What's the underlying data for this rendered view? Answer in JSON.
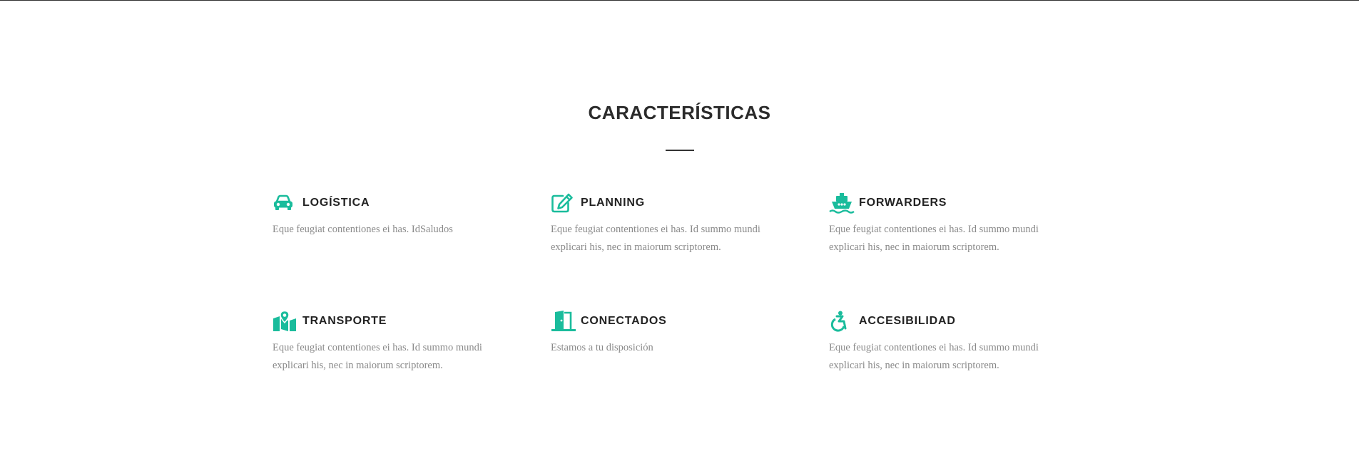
{
  "section": {
    "title": "CARACTERÍSTICAS"
  },
  "theme": {
    "accent": "#1abc9c",
    "heading": "#222222",
    "text": "#8a8a8a"
  },
  "features": [
    {
      "icon": "car-icon",
      "title": "LOGÍSTICA",
      "text": "Eque feugiat contentiones ei has. IdSaludos"
    },
    {
      "icon": "edit-icon",
      "title": "PLANNING",
      "text": "Eque feugiat contentiones ei has. Id summo mundi explicari his, nec in maiorum scriptorem."
    },
    {
      "icon": "ship-icon",
      "title": "FORWARDERS",
      "text": "Eque feugiat contentiones ei has. Id summo mundi explicari his, nec in maiorum scriptorem."
    },
    {
      "icon": "map-marker-icon",
      "title": "TRANSPORTE",
      "text": "Eque feugiat contentiones ei has. Id summo mundi explicari his, nec in maiorum scriptorem."
    },
    {
      "icon": "door-open-icon",
      "title": "CONECTADOS",
      "text": "Estamos a tu disposición"
    },
    {
      "icon": "wheelchair-icon",
      "title": "ACCESIBILIDAD",
      "text": "Eque feugiat contentiones ei has. Id summo mundi explicari his, nec in maiorum scriptorem."
    }
  ]
}
